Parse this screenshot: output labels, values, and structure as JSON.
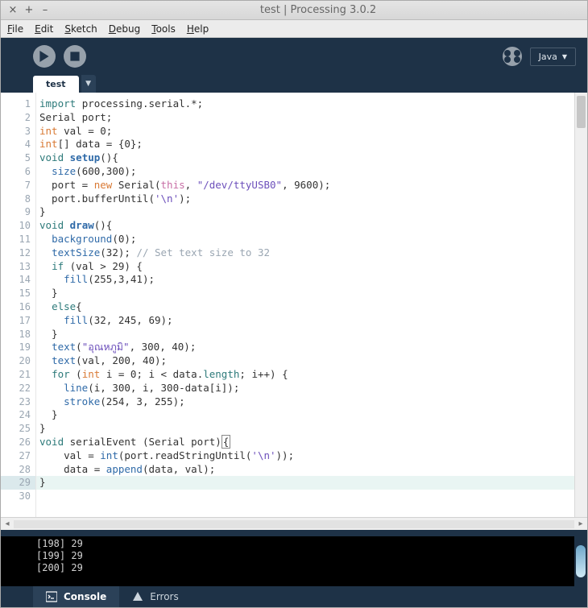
{
  "window": {
    "title": "test | Processing 3.0.2"
  },
  "menu": {
    "file": "File",
    "edit": "Edit",
    "sketch": "Sketch",
    "debug": "Debug",
    "tools": "Tools",
    "help": "Help"
  },
  "toolbar": {
    "mode_label": "Java"
  },
  "tabs": {
    "active": "test"
  },
  "editor": {
    "highlighted_line": 29,
    "lines": [
      {
        "n": 1,
        "tokens": [
          {
            "t": "import ",
            "c": "kw-ctrl"
          },
          {
            "t": "processing.serial.*;",
            "c": ""
          }
        ]
      },
      {
        "n": 2,
        "tokens": [
          {
            "t": "Serial port;",
            "c": ""
          }
        ]
      },
      {
        "n": 3,
        "tokens": [
          {
            "t": "int ",
            "c": "kw-type"
          },
          {
            "t": "val = 0;",
            "c": ""
          }
        ]
      },
      {
        "n": 4,
        "tokens": [
          {
            "t": "int",
            "c": "kw-type"
          },
          {
            "t": "[] data = {0};",
            "c": ""
          }
        ]
      },
      {
        "n": 5,
        "tokens": [
          {
            "t": "void ",
            "c": "kw-void"
          },
          {
            "t": "setup",
            "c": "fn-def"
          },
          {
            "t": "(){",
            "c": ""
          }
        ]
      },
      {
        "n": 6,
        "tokens": [
          {
            "t": "  ",
            "c": ""
          },
          {
            "t": "size",
            "c": "fn"
          },
          {
            "t": "(600,300);",
            "c": ""
          }
        ]
      },
      {
        "n": 7,
        "tokens": [
          {
            "t": "  port = ",
            "c": ""
          },
          {
            "t": "new ",
            "c": "kw-new"
          },
          {
            "t": "Serial(",
            "c": ""
          },
          {
            "t": "this",
            "c": "this"
          },
          {
            "t": ", ",
            "c": ""
          },
          {
            "t": "\"/dev/ttyUSB0\"",
            "c": "str"
          },
          {
            "t": ", 9600);",
            "c": ""
          }
        ]
      },
      {
        "n": 8,
        "tokens": [
          {
            "t": "  port.bufferUntil(",
            "c": ""
          },
          {
            "t": "'\\n'",
            "c": "chlit"
          },
          {
            "t": ");",
            "c": ""
          }
        ]
      },
      {
        "n": 9,
        "tokens": [
          {
            "t": "}",
            "c": ""
          }
        ]
      },
      {
        "n": 10,
        "tokens": [
          {
            "t": "void ",
            "c": "kw-void"
          },
          {
            "t": "draw",
            "c": "fn-def"
          },
          {
            "t": "(){",
            "c": ""
          }
        ]
      },
      {
        "n": 11,
        "tokens": [
          {
            "t": "  ",
            "c": ""
          },
          {
            "t": "background",
            "c": "fn"
          },
          {
            "t": "(0);",
            "c": ""
          }
        ]
      },
      {
        "n": 12,
        "tokens": [
          {
            "t": "  ",
            "c": ""
          },
          {
            "t": "textSize",
            "c": "fn"
          },
          {
            "t": "(32); ",
            "c": ""
          },
          {
            "t": "// Set text size to 32",
            "c": "cmt"
          }
        ]
      },
      {
        "n": 13,
        "tokens": [
          {
            "t": "  ",
            "c": ""
          },
          {
            "t": "if ",
            "c": "kw-ctrl"
          },
          {
            "t": "(val > 29) {",
            "c": ""
          }
        ]
      },
      {
        "n": 14,
        "tokens": [
          {
            "t": "    ",
            "c": ""
          },
          {
            "t": "fill",
            "c": "fn"
          },
          {
            "t": "(255,3,41);",
            "c": ""
          }
        ]
      },
      {
        "n": 15,
        "tokens": [
          {
            "t": "  }",
            "c": ""
          }
        ]
      },
      {
        "n": 16,
        "tokens": [
          {
            "t": "  ",
            "c": ""
          },
          {
            "t": "else",
            "c": "kw-ctrl"
          },
          {
            "t": "{",
            "c": ""
          }
        ]
      },
      {
        "n": 17,
        "tokens": [
          {
            "t": "    ",
            "c": ""
          },
          {
            "t": "fill",
            "c": "fn"
          },
          {
            "t": "(32, 245, 69);",
            "c": ""
          }
        ]
      },
      {
        "n": 18,
        "tokens": [
          {
            "t": "  }",
            "c": ""
          }
        ]
      },
      {
        "n": 19,
        "tokens": [
          {
            "t": "  ",
            "c": ""
          },
          {
            "t": "text",
            "c": "fn"
          },
          {
            "t": "(",
            "c": ""
          },
          {
            "t": "\"อุณหภูมิ\"",
            "c": "str"
          },
          {
            "t": ", 300, 40);",
            "c": ""
          }
        ]
      },
      {
        "n": 20,
        "tokens": [
          {
            "t": "  ",
            "c": ""
          },
          {
            "t": "text",
            "c": "fn"
          },
          {
            "t": "(val, 200, 40);",
            "c": ""
          }
        ]
      },
      {
        "n": 21,
        "tokens": [
          {
            "t": "  ",
            "c": ""
          },
          {
            "t": "for ",
            "c": "kw-ctrl"
          },
          {
            "t": "(",
            "c": ""
          },
          {
            "t": "int ",
            "c": "kw-type"
          },
          {
            "t": "i = 0; i < data.",
            "c": ""
          },
          {
            "t": "length",
            "c": "mem"
          },
          {
            "t": "; i++) {",
            "c": ""
          }
        ]
      },
      {
        "n": 22,
        "tokens": [
          {
            "t": "    ",
            "c": ""
          },
          {
            "t": "line",
            "c": "fn"
          },
          {
            "t": "(i, 300, i, 300-data[i]);",
            "c": ""
          }
        ]
      },
      {
        "n": 23,
        "tokens": [
          {
            "t": "    ",
            "c": ""
          },
          {
            "t": "stroke",
            "c": "fn"
          },
          {
            "t": "(254, 3, 255);",
            "c": ""
          }
        ]
      },
      {
        "n": 24,
        "tokens": [
          {
            "t": "  }",
            "c": ""
          }
        ]
      },
      {
        "n": 25,
        "tokens": [
          {
            "t": "}",
            "c": ""
          }
        ]
      },
      {
        "n": 26,
        "tokens": [
          {
            "t": "void ",
            "c": "kw-void"
          },
          {
            "t": "serialEvent (Serial port)",
            "c": ""
          },
          {
            "t": "{",
            "c": "box"
          }
        ]
      },
      {
        "n": 27,
        "tokens": [
          {
            "t": "    val = ",
            "c": ""
          },
          {
            "t": "int",
            "c": "fn"
          },
          {
            "t": "(port.readStringUntil(",
            "c": ""
          },
          {
            "t": "'\\n'",
            "c": "chlit"
          },
          {
            "t": "));",
            "c": ""
          }
        ]
      },
      {
        "n": 28,
        "tokens": [
          {
            "t": "    data = ",
            "c": ""
          },
          {
            "t": "append",
            "c": "fn"
          },
          {
            "t": "(data, val);",
            "c": ""
          }
        ]
      },
      {
        "n": 29,
        "tokens": [
          {
            "t": "}",
            "c": ""
          }
        ]
      },
      {
        "n": 30,
        "tokens": [
          {
            "t": "",
            "c": ""
          }
        ]
      }
    ]
  },
  "console": {
    "lines": [
      "[198] 29",
      "[199] 29",
      "[200] 29"
    ]
  },
  "bottom_tabs": {
    "console": "Console",
    "errors": "Errors"
  }
}
